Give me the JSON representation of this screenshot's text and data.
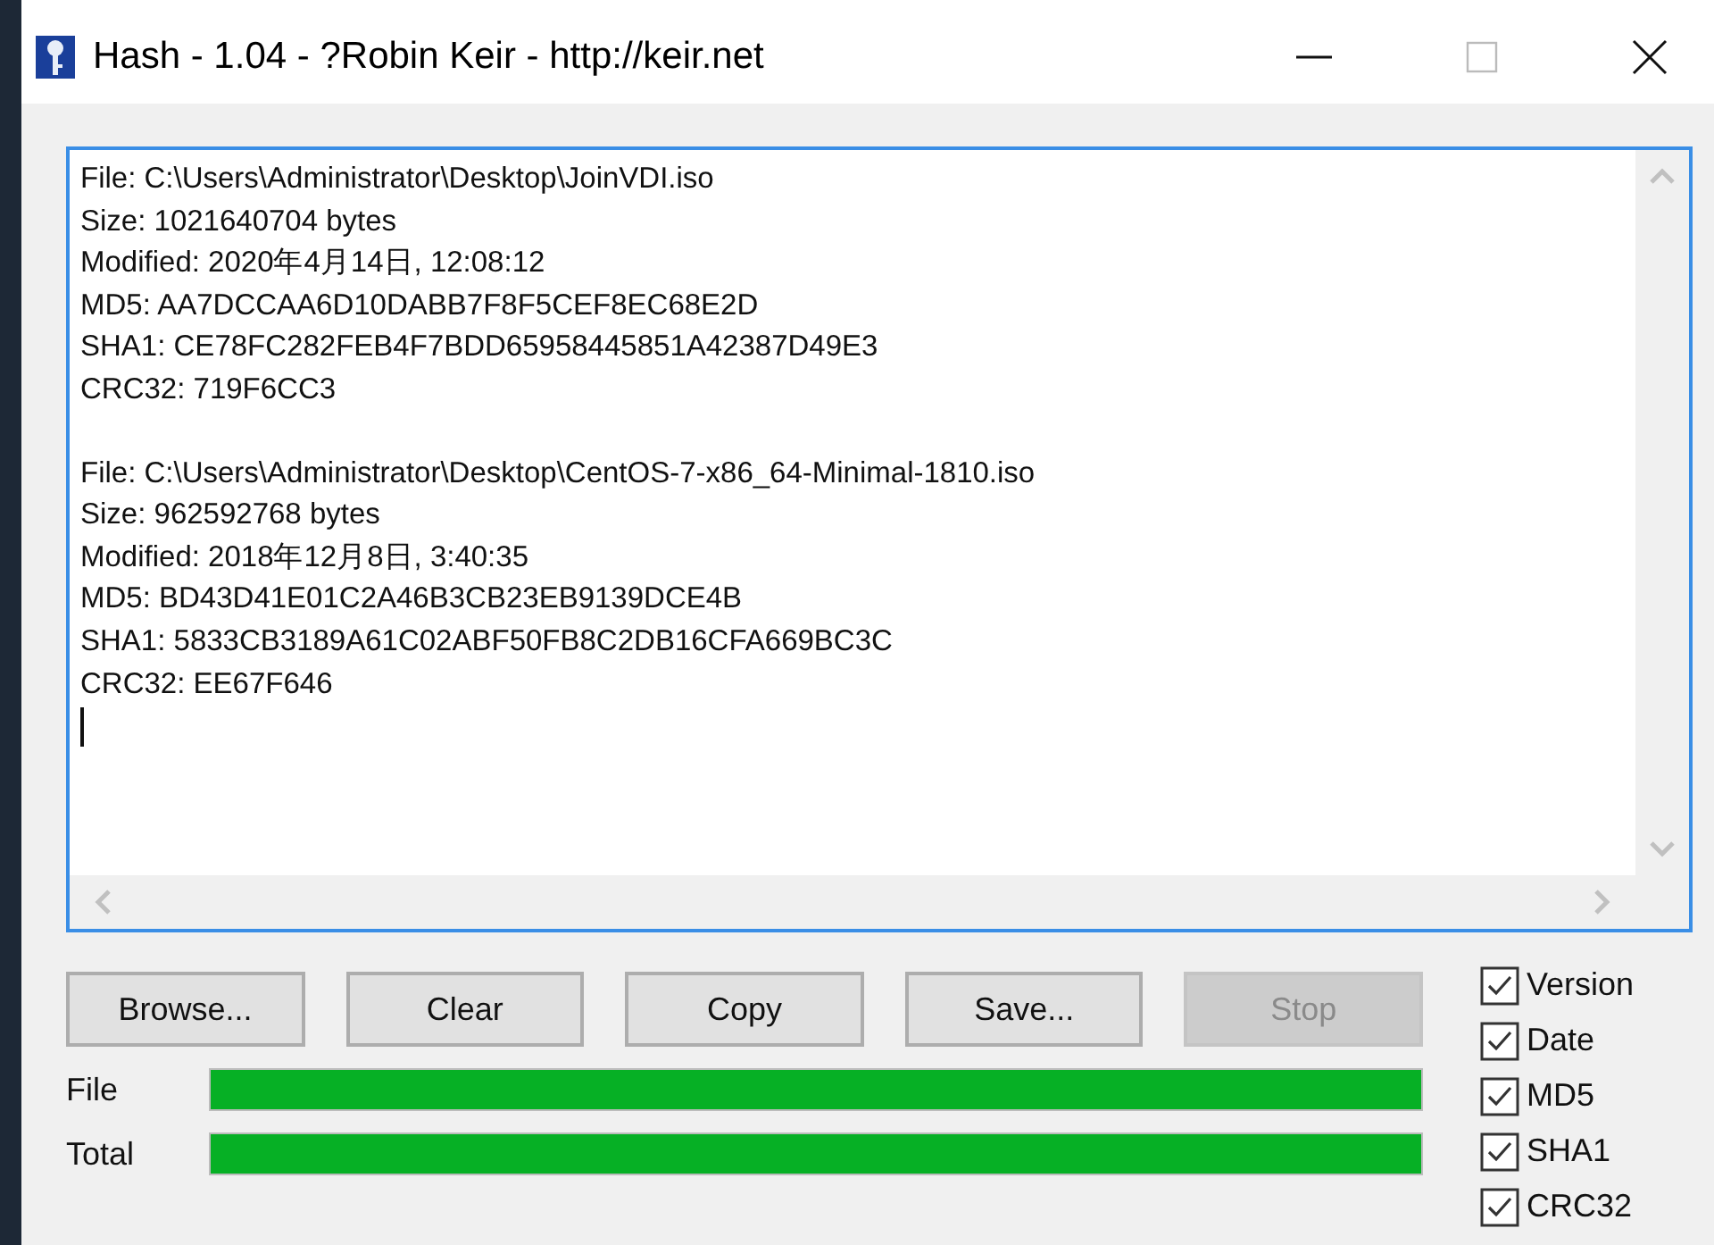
{
  "window": {
    "title": "Hash - 1.04 - ?Robin Keir - http://keir.net"
  },
  "output": {
    "entries": [
      {
        "lines": [
          "File: C:\\Users\\Administrator\\Desktop\\JoinVDI.iso",
          "Size: 1021640704 bytes",
          "Modified: 2020年4月14日, 12:08:12",
          "MD5: AA7DCCAA6D10DABB7F8F5CEF8EC68E2D",
          "SHA1: CE78FC282FEB4F7BDD65958445851A42387D49E3",
          "CRC32: 719F6CC3"
        ]
      },
      {
        "lines": [
          "File: C:\\Users\\Administrator\\Desktop\\CentOS-7-x86_64-Minimal-1810.iso",
          "Size: 962592768 bytes",
          "Modified: 2018年12月8日, 3:40:35",
          "MD5: BD43D41E01C2A46B3CB23EB9139DCE4B",
          "SHA1: 5833CB3189A61C02ABF50FB8C2DB16CFA669BC3C",
          "CRC32: EE67F646"
        ]
      }
    ]
  },
  "buttons": [
    {
      "label": "Browse...",
      "disabled": false
    },
    {
      "label": "Clear",
      "disabled": false
    },
    {
      "label": "Copy",
      "disabled": false
    },
    {
      "label": "Save...",
      "disabled": false
    },
    {
      "label": "Stop",
      "disabled": true
    }
  ],
  "progress": [
    {
      "label": "File",
      "level": 1.0
    },
    {
      "label": "Total",
      "level": 1.0
    }
  ],
  "options": [
    {
      "label": "Version",
      "checked": true
    },
    {
      "label": "Date",
      "checked": true
    },
    {
      "label": "MD5",
      "checked": true
    },
    {
      "label": "SHA1",
      "checked": true
    },
    {
      "label": "CRC32",
      "checked": true
    }
  ]
}
